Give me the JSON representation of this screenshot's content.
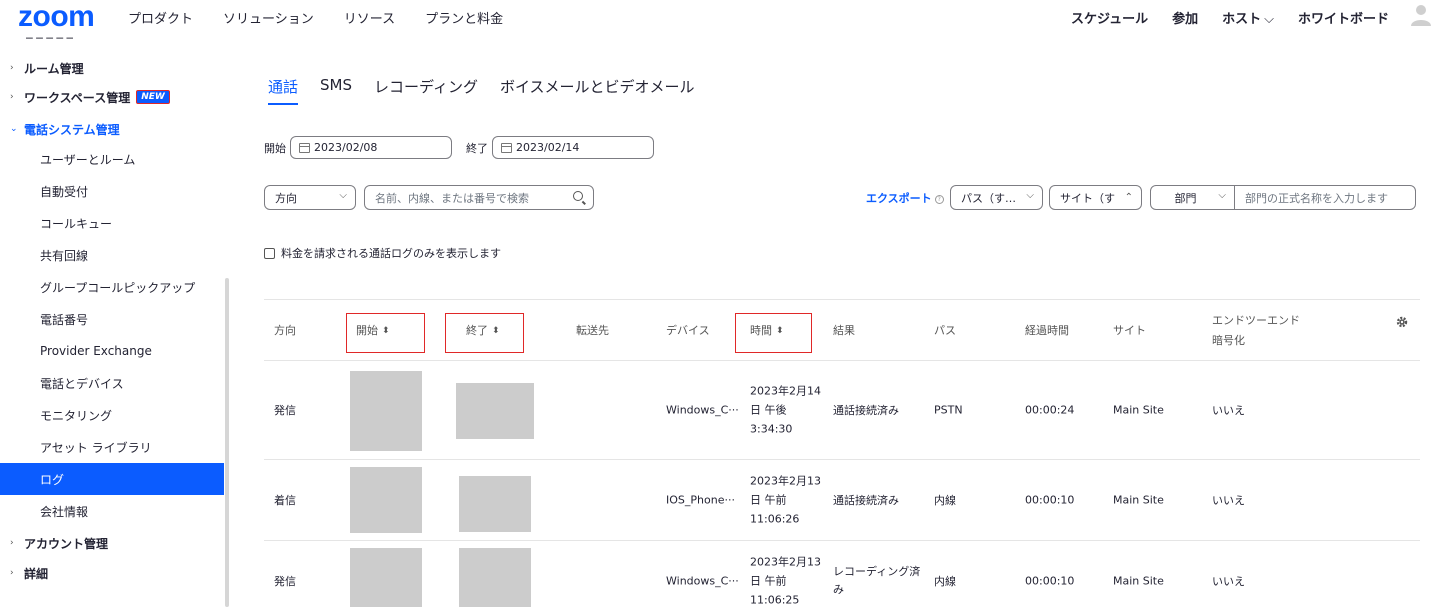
{
  "topnav": {
    "logo": "zoom",
    "left": [
      "プロダクト",
      "ソリューション",
      "リソース",
      "プランと料金"
    ],
    "right": {
      "schedule": "スケジュール",
      "join": "参加",
      "host": "ホスト",
      "whiteboard": "ホワイトボード"
    }
  },
  "sidebar": {
    "items": [
      {
        "label": "ルーム管理",
        "level": "top"
      },
      {
        "label": "ワークスペース管理",
        "level": "top",
        "badge": "NEW"
      },
      {
        "label": "電話システム管理",
        "level": "top",
        "open": true
      },
      {
        "label": "ユーザーとルーム",
        "level": "sub"
      },
      {
        "label": "自動受付",
        "level": "sub"
      },
      {
        "label": "コールキュー",
        "level": "sub"
      },
      {
        "label": "共有回線",
        "level": "sub"
      },
      {
        "label": "グループコールピックアップ",
        "level": "sub"
      },
      {
        "label": "電話番号",
        "level": "sub"
      },
      {
        "label": "Provider Exchange",
        "level": "sub"
      },
      {
        "label": "電話とデバイス",
        "level": "sub"
      },
      {
        "label": "モニタリング",
        "level": "sub"
      },
      {
        "label": "アセット ライブラリ",
        "level": "sub"
      },
      {
        "label": "ログ",
        "level": "sub",
        "active": true
      },
      {
        "label": "会社情報",
        "level": "sub"
      },
      {
        "label": "アカウント管理",
        "level": "top"
      },
      {
        "label": "詳細",
        "level": "top"
      }
    ]
  },
  "tabs": [
    "通話",
    "SMS",
    "レコーディング",
    "ボイスメールとビデオメール"
  ],
  "filters": {
    "start_label": "開始",
    "start_value": "2023/02/08",
    "end_label": "終了",
    "end_value": "2023/02/14",
    "direction_select": "方向",
    "search_placeholder": "名前、内線、または番号で検索",
    "export": "エクスポート",
    "path_select": "パス（す…",
    "site_select": "サイト（す",
    "dept_select": "部門",
    "dept_placeholder": "部門の正式名称を入力します",
    "billable_checkbox": "料金を請求される通話ログのみを表示します"
  },
  "table": {
    "headers": {
      "direction": "方向",
      "start": "開始",
      "end": "終了",
      "forward": "転送先",
      "device": "デバイス",
      "time": "時間",
      "result": "結果",
      "path": "パス",
      "duration": "経過時間",
      "site": "サイト",
      "e2e_line1": "エンドツーエンド",
      "e2e_line2": "暗号化"
    },
    "rows": [
      {
        "direction": "発信",
        "device": "Windows_C···",
        "time1": "2023年2月14",
        "time2": "日 午後",
        "time3": "3:34:30",
        "result1": "通話接続済み",
        "result2": "",
        "path": "PSTN",
        "duration": "00:00:24",
        "site": "Main Site",
        "e2e": "いいえ"
      },
      {
        "direction": "着信",
        "device": "IOS_Phone···",
        "time1": "2023年2月13",
        "time2": "日 午前",
        "time3": "11:06:26",
        "result1": "通話接続済み",
        "result2": "",
        "path": "内線",
        "duration": "00:00:10",
        "site": "Main Site",
        "e2e": "いいえ"
      },
      {
        "direction": "発信",
        "device": "Windows_C···",
        "time1": "2023年2月13",
        "time2": "日 午前",
        "time3": "11:06:25",
        "result1": "レコーディング済",
        "result2": "み",
        "path": "内線",
        "duration": "00:00:10",
        "site": "Main Site",
        "e2e": "いいえ"
      }
    ]
  }
}
